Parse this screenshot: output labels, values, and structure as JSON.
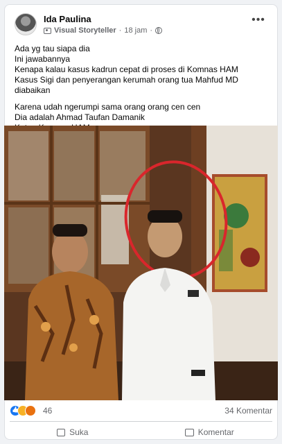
{
  "post": {
    "author": "Ida Paulina",
    "badge": "Visual Storyteller",
    "separator": "·",
    "time": "18 jam",
    "dot": "·",
    "more_label": "•••",
    "text_lines": [
      "Ada yg tau siapa dia",
      "Ini jawabannya",
      "Kenapa kalau kasus kadrun cepat di proses di Komnas HAM",
      "Kasus Sigi dan penyerangan kerumah orang tua Mahfud MD",
      "diabaikan",
      "Karena udah ngerumpi sama orang orang cen cen",
      "Dia adalah Ahmad Taufan Damanik",
      "Ketua Komnas HAM"
    ]
  },
  "stats": {
    "reaction_count": "46",
    "comments": "34 Komentar"
  },
  "actions": {
    "like_label": "Suka",
    "comment_label": "Komentar"
  },
  "icons": {
    "like": "thumbs-up-icon",
    "comment": "comment-bubble-icon",
    "privacy": "globe-icon"
  },
  "colors": {
    "brand": "#1877f2",
    "circle": "#d9262c"
  }
}
